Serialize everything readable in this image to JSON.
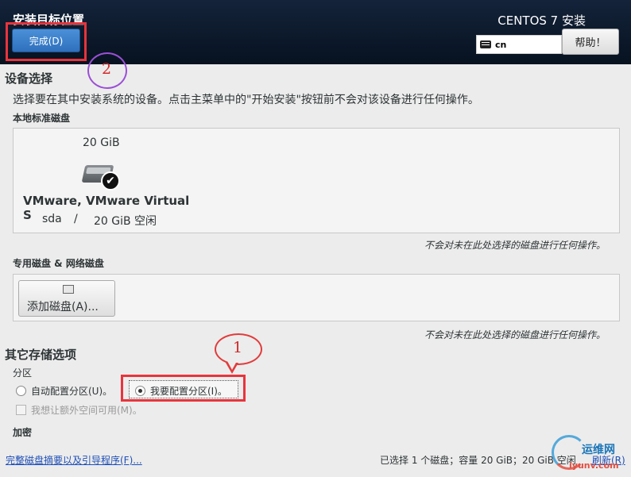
{
  "header": {
    "title": "安装目标位置",
    "done_label": "完成(D)",
    "product": "CENTOS 7 安装",
    "keyboard_layout": "cn",
    "help_label": "帮助！"
  },
  "device_selection": {
    "title": "设备选择",
    "description": "选择要在其中安装系统的设备。点击主菜单中的\"开始安装\"按钮前不会对该设备进行任何操作。",
    "local_disks_title": "本地标准磁盘",
    "disk": {
      "size": "20 GiB",
      "name": "VMware, VMware Virtual S",
      "device": "sda",
      "separator": "/",
      "free": "20 GiB 空闲",
      "selected": true
    },
    "local_note": "不会对未在此处选择的磁盘进行任何操作。",
    "special_disks_title": "专用磁盘 & 网络磁盘",
    "add_disk_label": "添加磁盘(A)...",
    "special_note": "不会对未在此处选择的磁盘进行任何操作。"
  },
  "other_options": {
    "title": "其它存储选项",
    "partition_title": "分区",
    "auto_label": "自动配置分区(U)。",
    "manual_label": "我要配置分区(I)。",
    "selected": "manual",
    "extra_space_label": "我想让额外空间可用(M)。",
    "encryption_title": "加密"
  },
  "footer": {
    "summary_link": "完整磁盘摘要以及引导程序(F)...",
    "status": "已选择 1 个磁盘；容量 20 GiB；20 GiB 空闲",
    "refresh_label": "刷新(R)"
  },
  "annotations": {
    "step1": "1",
    "step2": "2"
  },
  "watermark": {
    "name": "运维网",
    "url": "iyunv.com"
  },
  "colors": {
    "header_bg": "#0b1a2e",
    "primary_button": "#3a80cc",
    "annotation_red": "#e8343c",
    "annotation_purple": "#9b4fd6",
    "link": "#1f4fb8"
  }
}
